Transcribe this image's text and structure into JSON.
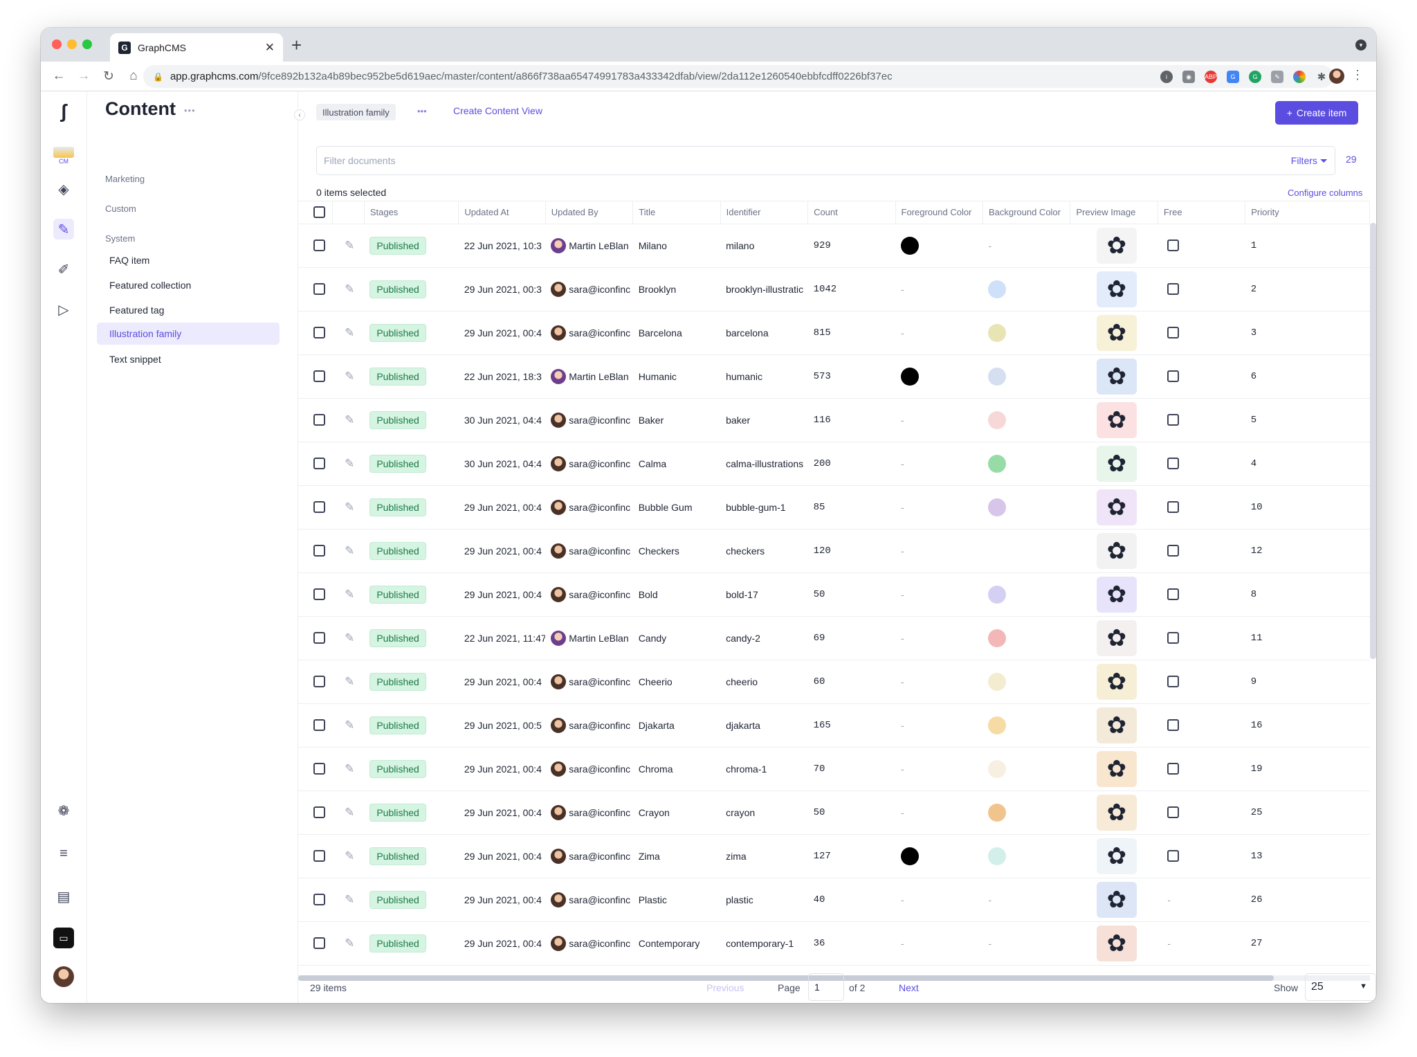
{
  "browser": {
    "tab_title": "GraphCMS",
    "tab_favicon": "G",
    "url_host": "app.graphcms.com",
    "url_path": "/9fce892b132a4b89bec952be5d619aec/master/content/a866f738aa65474991783a433342dfab/view/2da112e1260540ebbfcdff0226bf37ec",
    "colors": {
      "close": "#ff5f57",
      "minimize": "#febc2e",
      "maximize": "#28c840"
    }
  },
  "sidebar": {
    "title": "Content",
    "groups": [
      {
        "label": "Marketing"
      },
      {
        "label": "Custom"
      },
      {
        "label": "System"
      }
    ],
    "items": [
      {
        "label": "FAQ item"
      },
      {
        "label": "Featured collection"
      },
      {
        "label": "Featured tag"
      },
      {
        "label": "Illustration family"
      },
      {
        "label": "Text snippet"
      }
    ],
    "rail_cm": "CM"
  },
  "header": {
    "view_chip": "Illustration family",
    "create_view": "Create Content View",
    "create_item": "Create item"
  },
  "filter": {
    "placeholder": "Filter documents",
    "filters_label": "Filters",
    "total": "29"
  },
  "selection": {
    "label": "0 items selected",
    "configure": "Configure columns"
  },
  "columns": [
    "Stages",
    "Updated At",
    "Updated By",
    "Title",
    "Identifier",
    "Count",
    "Foreground Color",
    "Background Color",
    "Preview Image",
    "Free",
    "Priority"
  ],
  "rows": [
    {
      "stage": "Published",
      "updated_at": "22 Jun 2021, 10:3",
      "user": "Martin LeBlan",
      "title": "Milano",
      "identifier": "milano",
      "count": "929",
      "fg": "#000000",
      "bg": "",
      "free": true,
      "priority": "1",
      "thumb": "#f4f4f4"
    },
    {
      "stage": "Published",
      "updated_at": "29 Jun 2021, 00:3",
      "user": "sara@iconfinc",
      "title": "Brooklyn",
      "identifier": "brooklyn-illustratic",
      "count": "1042",
      "fg": "",
      "bg": "#cfe0fb",
      "free": true,
      "priority": "2",
      "thumb": "#e3ecfb"
    },
    {
      "stage": "Published",
      "updated_at": "29 Jun 2021, 00:4",
      "user": "sara@iconfinc",
      "title": "Barcelona",
      "identifier": "barcelona",
      "count": "815",
      "fg": "",
      "bg": "#e8e4b4",
      "free": true,
      "priority": "3",
      "thumb": "#f7f1d8"
    },
    {
      "stage": "Published",
      "updated_at": "22 Jun 2021, 18:3",
      "user": "Martin LeBlan",
      "title": "Humanic",
      "identifier": "humanic",
      "count": "573",
      "fg": "#000000",
      "bg": "#d6dff0",
      "free": true,
      "priority": "6",
      "thumb": "#dbe6f7"
    },
    {
      "stage": "Published",
      "updated_at": "30 Jun 2021, 04:4",
      "user": "sara@iconfinc",
      "title": "Baker",
      "identifier": "baker",
      "count": "116",
      "fg": "",
      "bg": "#f7d8d8",
      "free": true,
      "priority": "5",
      "thumb": "#fbe1e1"
    },
    {
      "stage": "Published",
      "updated_at": "30 Jun 2021, 04:4",
      "user": "sara@iconfinc",
      "title": "Calma",
      "identifier": "calma-illustrations",
      "count": "200",
      "fg": "",
      "bg": "#97dca6",
      "free": true,
      "priority": "4",
      "thumb": "#e7f5ea"
    },
    {
      "stage": "Published",
      "updated_at": "29 Jun 2021, 00:4",
      "user": "sara@iconfinc",
      "title": "Bubble Gum",
      "identifier": "bubble-gum-1",
      "count": "85",
      "fg": "",
      "bg": "#d7c5ea",
      "free": true,
      "priority": "10",
      "thumb": "#efe4f8"
    },
    {
      "stage": "Published",
      "updated_at": "29 Jun 2021, 00:4",
      "user": "sara@iconfinc",
      "title": "Checkers",
      "identifier": "checkers",
      "count": "120",
      "fg": "",
      "bg": "",
      "free": true,
      "priority": "12",
      "thumb": "#f2f2f2"
    },
    {
      "stage": "Published",
      "updated_at": "29 Jun 2021, 00:4",
      "user": "sara@iconfinc",
      "title": "Bold",
      "identifier": "bold-17",
      "count": "50",
      "fg": "",
      "bg": "#d4d0f4",
      "free": true,
      "priority": "8",
      "thumb": "#e7e3fb"
    },
    {
      "stage": "Published",
      "updated_at": "22 Jun 2021, 11:47",
      "user": "Martin LeBlan",
      "title": "Candy",
      "identifier": "candy-2",
      "count": "69",
      "fg": "",
      "bg": "#f4b7b7",
      "free": true,
      "priority": "11",
      "thumb": "#f5f0f0"
    },
    {
      "stage": "Published",
      "updated_at": "29 Jun 2021, 00:4",
      "user": "sara@iconfinc",
      "title": "Cheerio",
      "identifier": "cheerio",
      "count": "60",
      "fg": "",
      "bg": "#f3ecd0",
      "free": true,
      "priority": "9",
      "thumb": "#f6efd6"
    },
    {
      "stage": "Published",
      "updated_at": "29 Jun 2021, 00:5",
      "user": "sara@iconfinc",
      "title": "Djakarta",
      "identifier": "djakarta",
      "count": "165",
      "fg": "",
      "bg": "#f6dca4",
      "free": true,
      "priority": "16",
      "thumb": "#f3ead9"
    },
    {
      "stage": "Published",
      "updated_at": "29 Jun 2021, 00:4",
      "user": "sara@iconfinc",
      "title": "Chroma",
      "identifier": "chroma-1",
      "count": "70",
      "fg": "",
      "bg": "#f7efe2",
      "free": true,
      "priority": "19",
      "thumb": "#f8e6cf"
    },
    {
      "stage": "Published",
      "updated_at": "29 Jun 2021, 00:4",
      "user": "sara@iconfinc",
      "title": "Crayon",
      "identifier": "crayon",
      "count": "50",
      "fg": "",
      "bg": "#f1c48e",
      "free": true,
      "priority": "25",
      "thumb": "#f7ead7"
    },
    {
      "stage": "Published",
      "updated_at": "29 Jun 2021, 00:4",
      "user": "sara@iconfinc",
      "title": "Zima",
      "identifier": "zima",
      "count": "127",
      "fg": "#000000",
      "bg": "#d3efe9",
      "free": true,
      "priority": "13",
      "thumb": "#eef4f7"
    },
    {
      "stage": "Published",
      "updated_at": "29 Jun 2021, 00:4",
      "user": "sara@iconfinc",
      "title": "Plastic",
      "identifier": "plastic",
      "count": "40",
      "fg": "",
      "bg": "",
      "free": false,
      "priority": "26",
      "thumb": "#dde6f6"
    },
    {
      "stage": "Published",
      "updated_at": "29 Jun 2021, 00:4",
      "user": "sara@iconfinc",
      "title": "Contemporary",
      "identifier": "contemporary-1",
      "count": "36",
      "fg": "",
      "bg": "",
      "free": false,
      "priority": "27",
      "thumb": "#f6e0d7"
    }
  ],
  "footer": {
    "items": "29 items",
    "previous": "Previous",
    "page_label": "Page",
    "page_value": "1",
    "of": "of 2",
    "next": "Next",
    "show_label": "Show",
    "show_value": "25"
  },
  "empty_value": "-",
  "accent": "#5b4de0"
}
